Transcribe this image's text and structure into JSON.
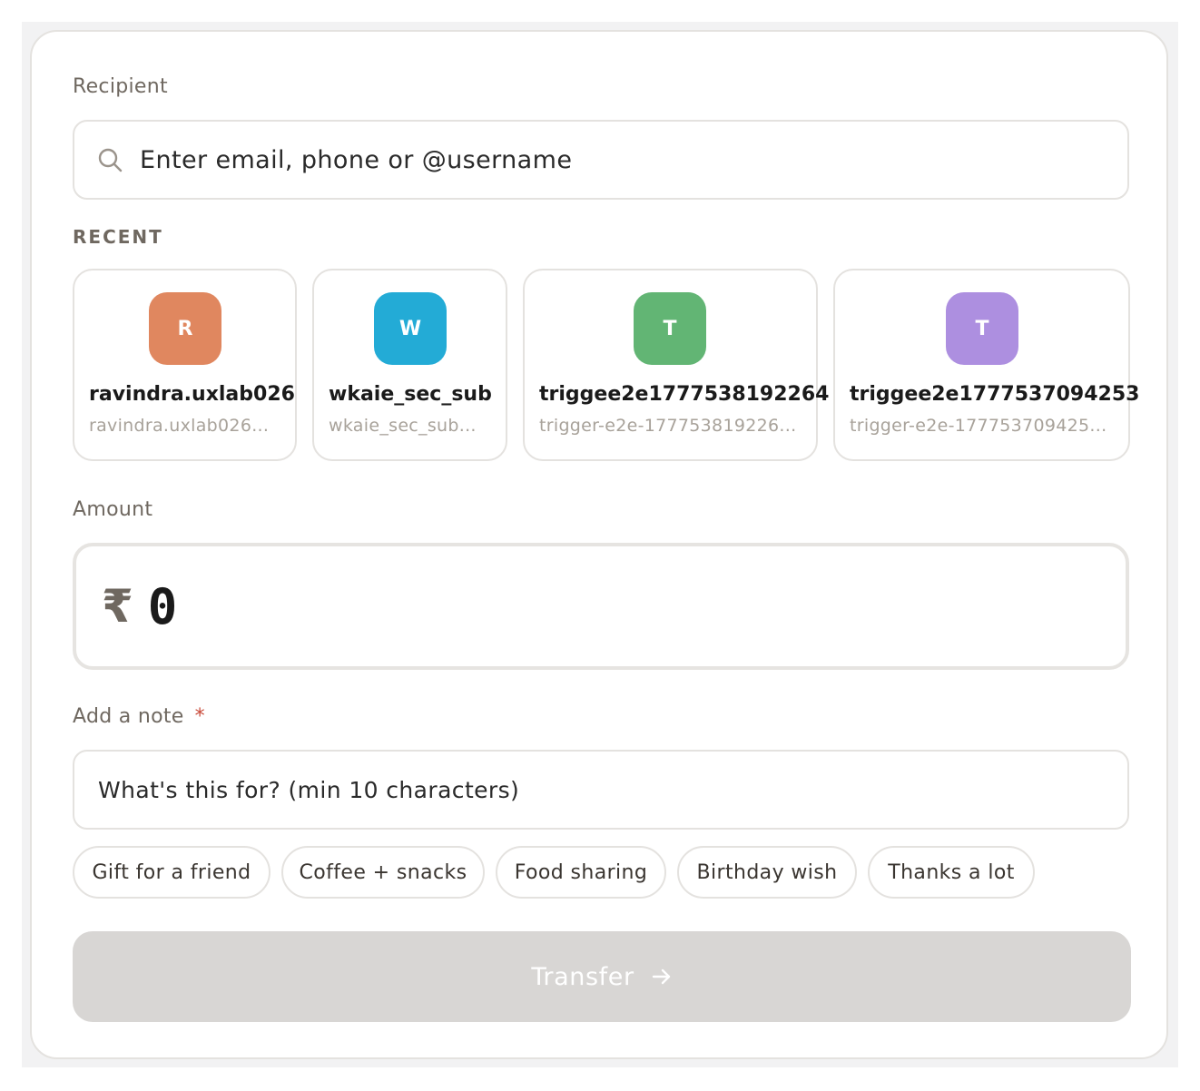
{
  "recipient": {
    "label": "Recipient",
    "placeholder": "Enter email, phone or @username",
    "search_icon": "search-icon"
  },
  "recent": {
    "label": "RECENT",
    "items": [
      {
        "initial": "R",
        "name": "ravindra.uxlab026",
        "sub": "ravindra.uxlab026...",
        "color": "#e0875f"
      },
      {
        "initial": "W",
        "name": "wkaie_sec_sub",
        "sub": "wkaie_sec_sub...",
        "color": "#23abd6"
      },
      {
        "initial": "T",
        "name": "triggee2e1777538192264",
        "sub": "trigger-e2e-177753819226...",
        "color": "#62b574"
      },
      {
        "initial": "T",
        "name": "triggee2e1777537094253",
        "sub": "trigger-e2e-177753709425...",
        "color": "#ad8fe0"
      }
    ]
  },
  "amount": {
    "label": "Amount",
    "currency": "₹",
    "value": "0"
  },
  "note": {
    "label": "Add a note",
    "required_mark": "*",
    "placeholder": "What's this for? (min 10 characters)",
    "suggestions": [
      "Gift for a friend",
      "Coffee + snacks",
      "Food sharing",
      "Birthday wish",
      "Thanks a lot"
    ]
  },
  "transfer": {
    "label": "Transfer",
    "icon": "arrow-right-icon"
  }
}
